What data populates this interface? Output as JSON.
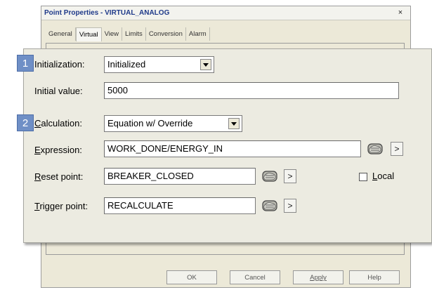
{
  "window": {
    "title": "Point Properties - VIRTUAL_ANALOG",
    "close_glyph": "×"
  },
  "tabs": [
    {
      "label": "General"
    },
    {
      "label": "Virtual",
      "active": true
    },
    {
      "label": "View"
    },
    {
      "label": "Limits"
    },
    {
      "label": "Conversion"
    },
    {
      "label": "Alarm"
    }
  ],
  "badges": {
    "one": "1",
    "two": "2"
  },
  "initialization": {
    "label": "Initialization:",
    "value": "Initialized"
  },
  "initial_value": {
    "label": "Initial value:",
    "value": "5000"
  },
  "calculation": {
    "label_underlined": "C",
    "label_rest": "alculation:",
    "value": "Equation w/ Override"
  },
  "expression": {
    "label_underlined": "E",
    "label_rest": "xpression:",
    "value": "WORK_DONE/ENERGY_IN"
  },
  "reset_point": {
    "label_underlined": "R",
    "label_rest": "eset point:",
    "value": "BREAKER_CLOSED"
  },
  "trigger_point": {
    "label_underlined": "T",
    "label_rest": "rigger point:",
    "value": "RECALCULATE"
  },
  "local": {
    "label_underlined": "L",
    "label_rest": "ocal",
    "checked": false
  },
  "arrow_glyph": ">",
  "footer": {
    "ok": "OK",
    "cancel": "Cancel",
    "apply": "Apply",
    "help": "Help"
  },
  "colors": {
    "badge": "#6f8fc6",
    "panel": "#ecebe1",
    "title_text": "#1f3a8a"
  }
}
